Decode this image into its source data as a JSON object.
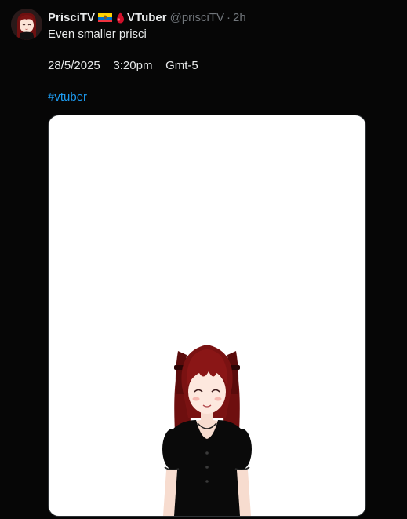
{
  "post": {
    "author": {
      "display_name": "PrisciTV",
      "display_name_suffix": "VTuber",
      "handle": "@prisciTV",
      "name_emojis": [
        "ecuador-flag-icon",
        "blood-drop-icon"
      ],
      "avatar": "anime-girl-avatar"
    },
    "separator": "·",
    "time": "2h",
    "text_line1": "Even smaller prisci",
    "text_line2": "28/5/2025    3:20pm    Gmt-5",
    "hashtag": "#vtuber",
    "media": {
      "kind": "image",
      "subject": "vtuber-model-image"
    }
  },
  "colors": {
    "background": "#060606",
    "text": "#e7e9ea",
    "muted": "#71767b",
    "link": "#1d9bf0",
    "media_background": "#ffffff",
    "hair": "#7a1212",
    "dress": "#0a0a0a"
  }
}
